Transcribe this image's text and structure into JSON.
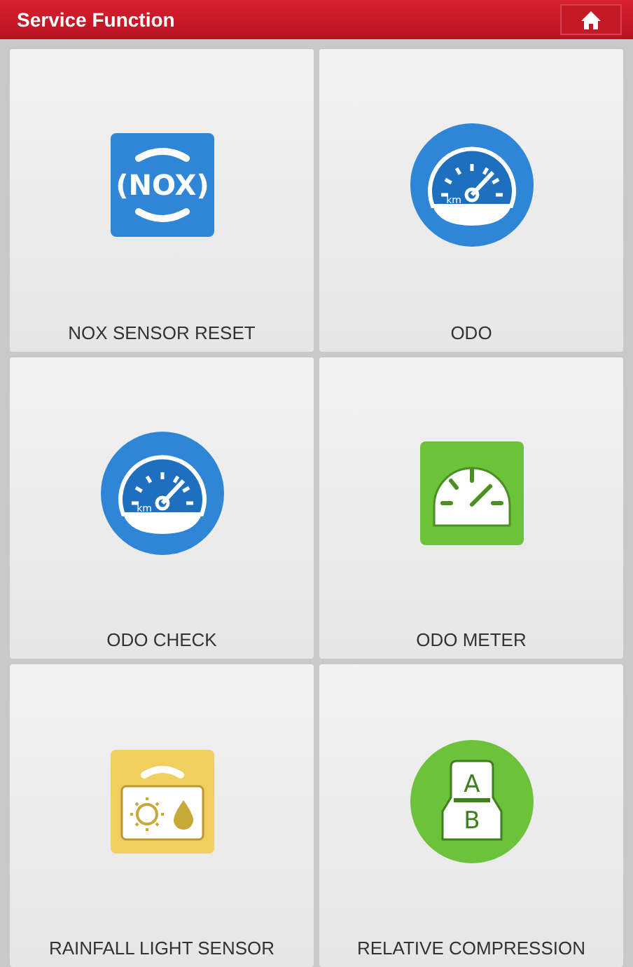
{
  "header": {
    "title": "Service Function"
  },
  "tiles": [
    {
      "label": "NOX SENSOR RESET",
      "icon": {
        "kind": "nox",
        "texts": [
          "(NOX)"
        ]
      }
    },
    {
      "label": "ODO",
      "icon": {
        "kind": "odo",
        "texts": [
          "km"
        ]
      }
    },
    {
      "label": "ODO CHECK",
      "icon": {
        "kind": "odo",
        "texts": [
          "km"
        ]
      }
    },
    {
      "label": "ODO METER",
      "icon": {
        "kind": "meter"
      }
    },
    {
      "label": "RAINFALL LIGHT SENSOR",
      "icon": {
        "kind": "rain"
      }
    },
    {
      "label": "RELATIVE COMPRESSION",
      "icon": {
        "kind": "ab",
        "texts": [
          "A",
          "B"
        ]
      }
    }
  ]
}
